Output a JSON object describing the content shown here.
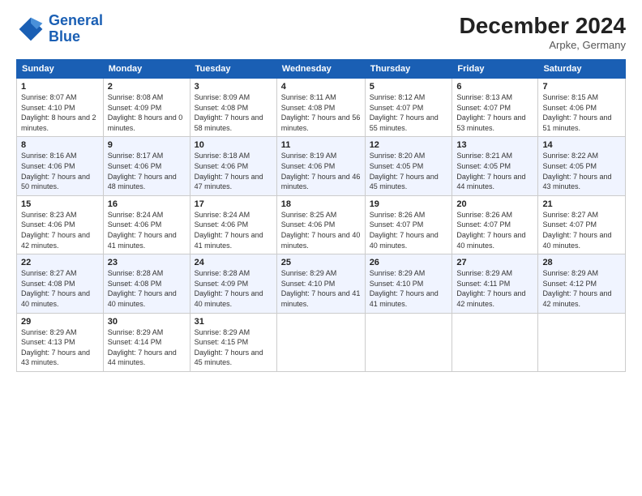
{
  "header": {
    "logo_line1": "General",
    "logo_line2": "Blue",
    "month": "December 2024",
    "location": "Arpke, Germany"
  },
  "weekdays": [
    "Sunday",
    "Monday",
    "Tuesday",
    "Wednesday",
    "Thursday",
    "Friday",
    "Saturday"
  ],
  "weeks": [
    [
      {
        "day": "1",
        "sunrise": "8:07 AM",
        "sunset": "4:10 PM",
        "daylight": "8 hours and 2 minutes."
      },
      {
        "day": "2",
        "sunrise": "8:08 AM",
        "sunset": "4:09 PM",
        "daylight": "8 hours and 0 minutes."
      },
      {
        "day": "3",
        "sunrise": "8:09 AM",
        "sunset": "4:08 PM",
        "daylight": "7 hours and 58 minutes."
      },
      {
        "day": "4",
        "sunrise": "8:11 AM",
        "sunset": "4:08 PM",
        "daylight": "7 hours and 56 minutes."
      },
      {
        "day": "5",
        "sunrise": "8:12 AM",
        "sunset": "4:07 PM",
        "daylight": "7 hours and 55 minutes."
      },
      {
        "day": "6",
        "sunrise": "8:13 AM",
        "sunset": "4:07 PM",
        "daylight": "7 hours and 53 minutes."
      },
      {
        "day": "7",
        "sunrise": "8:15 AM",
        "sunset": "4:06 PM",
        "daylight": "7 hours and 51 minutes."
      }
    ],
    [
      {
        "day": "8",
        "sunrise": "8:16 AM",
        "sunset": "4:06 PM",
        "daylight": "7 hours and 50 minutes."
      },
      {
        "day": "9",
        "sunrise": "8:17 AM",
        "sunset": "4:06 PM",
        "daylight": "7 hours and 48 minutes."
      },
      {
        "day": "10",
        "sunrise": "8:18 AM",
        "sunset": "4:06 PM",
        "daylight": "7 hours and 47 minutes."
      },
      {
        "day": "11",
        "sunrise": "8:19 AM",
        "sunset": "4:06 PM",
        "daylight": "7 hours and 46 minutes."
      },
      {
        "day": "12",
        "sunrise": "8:20 AM",
        "sunset": "4:05 PM",
        "daylight": "7 hours and 45 minutes."
      },
      {
        "day": "13",
        "sunrise": "8:21 AM",
        "sunset": "4:05 PM",
        "daylight": "7 hours and 44 minutes."
      },
      {
        "day": "14",
        "sunrise": "8:22 AM",
        "sunset": "4:05 PM",
        "daylight": "7 hours and 43 minutes."
      }
    ],
    [
      {
        "day": "15",
        "sunrise": "8:23 AM",
        "sunset": "4:06 PM",
        "daylight": "7 hours and 42 minutes."
      },
      {
        "day": "16",
        "sunrise": "8:24 AM",
        "sunset": "4:06 PM",
        "daylight": "7 hours and 41 minutes."
      },
      {
        "day": "17",
        "sunrise": "8:24 AM",
        "sunset": "4:06 PM",
        "daylight": "7 hours and 41 minutes."
      },
      {
        "day": "18",
        "sunrise": "8:25 AM",
        "sunset": "4:06 PM",
        "daylight": "7 hours and 40 minutes."
      },
      {
        "day": "19",
        "sunrise": "8:26 AM",
        "sunset": "4:07 PM",
        "daylight": "7 hours and 40 minutes."
      },
      {
        "day": "20",
        "sunrise": "8:26 AM",
        "sunset": "4:07 PM",
        "daylight": "7 hours and 40 minutes."
      },
      {
        "day": "21",
        "sunrise": "8:27 AM",
        "sunset": "4:07 PM",
        "daylight": "7 hours and 40 minutes."
      }
    ],
    [
      {
        "day": "22",
        "sunrise": "8:27 AM",
        "sunset": "4:08 PM",
        "daylight": "7 hours and 40 minutes."
      },
      {
        "day": "23",
        "sunrise": "8:28 AM",
        "sunset": "4:08 PM",
        "daylight": "7 hours and 40 minutes."
      },
      {
        "day": "24",
        "sunrise": "8:28 AM",
        "sunset": "4:09 PM",
        "daylight": "7 hours and 40 minutes."
      },
      {
        "day": "25",
        "sunrise": "8:29 AM",
        "sunset": "4:10 PM",
        "daylight": "7 hours and 41 minutes."
      },
      {
        "day": "26",
        "sunrise": "8:29 AM",
        "sunset": "4:10 PM",
        "daylight": "7 hours and 41 minutes."
      },
      {
        "day": "27",
        "sunrise": "8:29 AM",
        "sunset": "4:11 PM",
        "daylight": "7 hours and 42 minutes."
      },
      {
        "day": "28",
        "sunrise": "8:29 AM",
        "sunset": "4:12 PM",
        "daylight": "7 hours and 42 minutes."
      }
    ],
    [
      {
        "day": "29",
        "sunrise": "8:29 AM",
        "sunset": "4:13 PM",
        "daylight": "7 hours and 43 minutes."
      },
      {
        "day": "30",
        "sunrise": "8:29 AM",
        "sunset": "4:14 PM",
        "daylight": "7 hours and 44 minutes."
      },
      {
        "day": "31",
        "sunrise": "8:29 AM",
        "sunset": "4:15 PM",
        "daylight": "7 hours and 45 minutes."
      },
      null,
      null,
      null,
      null
    ]
  ]
}
